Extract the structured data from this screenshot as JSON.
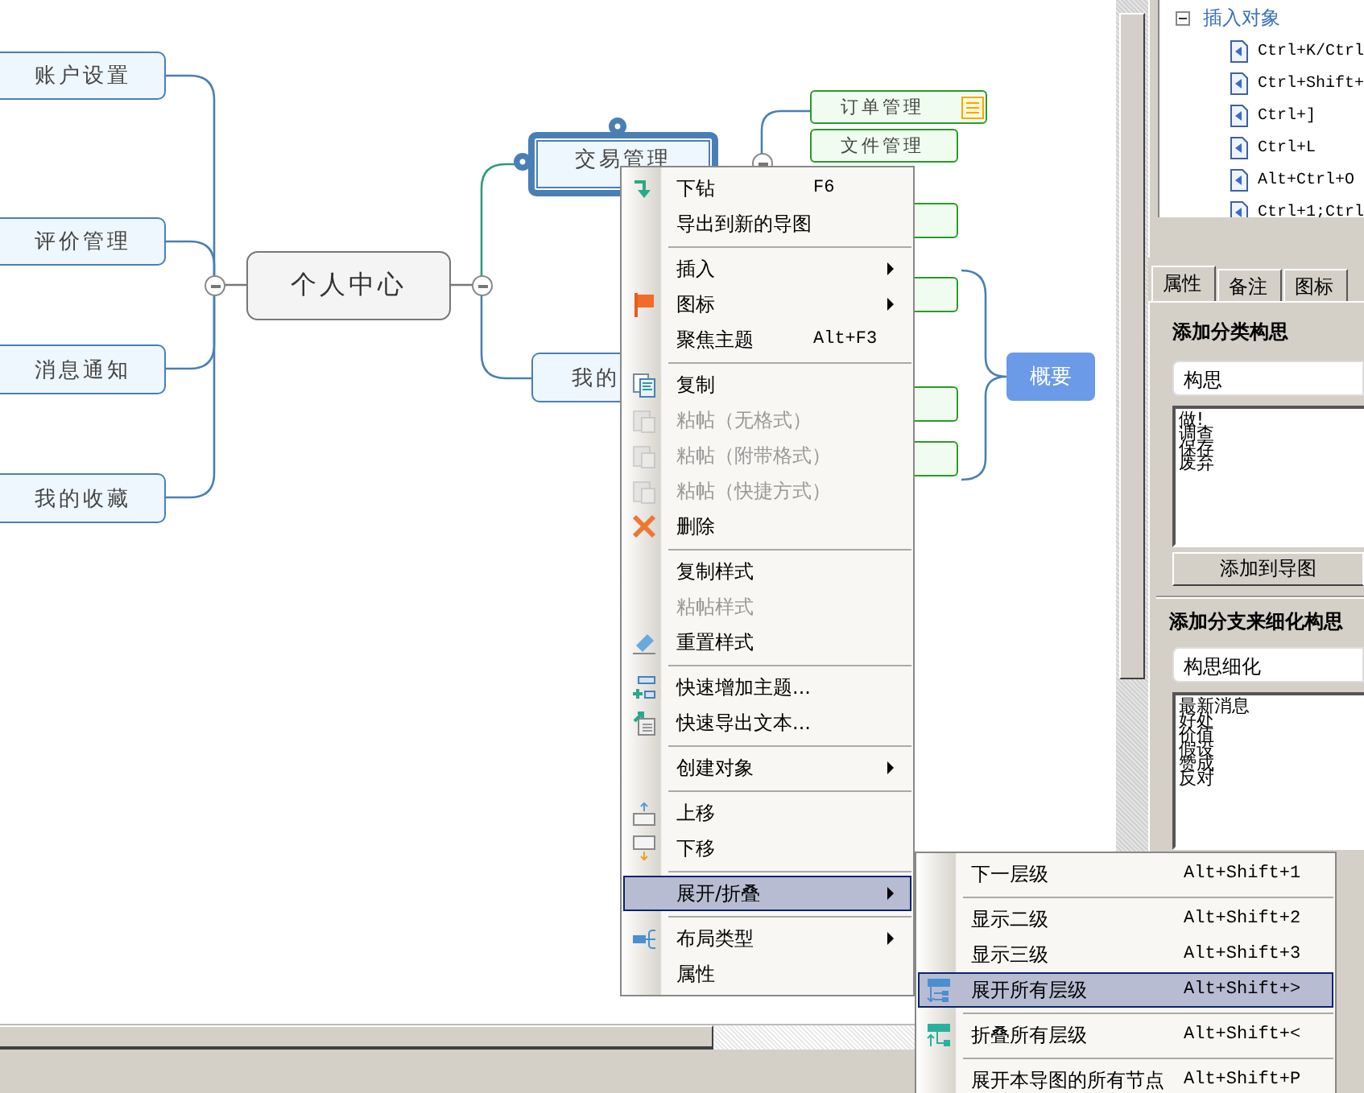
{
  "mind_map": {
    "left_topics": [
      {
        "text": "账户设置"
      },
      {
        "text": "评价管理"
      },
      {
        "text": "消息通知"
      },
      {
        "text": "我的收藏"
      }
    ],
    "central_topic": {
      "text": "个人中心"
    },
    "right_topics": [
      {
        "text": "交易管理",
        "selected": true
      },
      {
        "text": "我的",
        "selected": false
      }
    ],
    "subtopics": [
      {
        "kind": "topic",
        "text": "订单管理",
        "has_note": true
      },
      {
        "kind": "topic",
        "text": "文件管理",
        "has_note": false
      },
      {
        "kind": "blank",
        "has_note": false
      },
      {
        "kind": "blank",
        "has_note": false
      },
      {
        "kind": "blank",
        "has_note": false
      },
      {
        "kind": "blank",
        "has_note": false
      }
    ],
    "summary": {
      "text": "概要"
    }
  },
  "context_menu": {
    "items": [
      {
        "kind": "item",
        "label": "下钻",
        "shortcut": "F6",
        "has_submenu": false,
        "disabled": false,
        "selected": false
      },
      {
        "kind": "item",
        "label": "导出到新的导图",
        "has_submenu": false,
        "disabled": false,
        "selected": false
      },
      {
        "kind": "separator"
      },
      {
        "kind": "item",
        "label": "插入",
        "has_submenu": true,
        "disabled": false,
        "selected": false
      },
      {
        "kind": "item",
        "label": "图标",
        "has_submenu": true,
        "disabled": false,
        "selected": false
      },
      {
        "kind": "item",
        "label": "聚焦主题",
        "shortcut": "Alt+F3",
        "has_submenu": false,
        "disabled": false,
        "selected": false
      },
      {
        "kind": "separator"
      },
      {
        "kind": "item",
        "label": "复制",
        "has_submenu": false,
        "disabled": false,
        "selected": false
      },
      {
        "kind": "item",
        "label": "粘帖（无格式）",
        "has_submenu": false,
        "disabled": true,
        "selected": false
      },
      {
        "kind": "item",
        "label": "粘帖（附带格式）",
        "has_submenu": false,
        "disabled": true,
        "selected": false
      },
      {
        "kind": "item",
        "label": "粘帖（快捷方式）",
        "has_submenu": false,
        "disabled": true,
        "selected": false
      },
      {
        "kind": "item",
        "label": "删除",
        "has_submenu": false,
        "disabled": false,
        "selected": false
      },
      {
        "kind": "separator"
      },
      {
        "kind": "item",
        "label": "复制样式",
        "has_submenu": false,
        "disabled": false,
        "selected": false
      },
      {
        "kind": "item",
        "label": "粘帖样式",
        "has_submenu": false,
        "disabled": true,
        "selected": false
      },
      {
        "kind": "item",
        "label": "重置样式",
        "has_submenu": false,
        "disabled": false,
        "selected": false
      },
      {
        "kind": "separator"
      },
      {
        "kind": "item",
        "label": "快速增加主题...",
        "has_submenu": false,
        "disabled": false,
        "selected": false
      },
      {
        "kind": "item",
        "label": "快速导出文本...",
        "has_submenu": false,
        "disabled": false,
        "selected": false
      },
      {
        "kind": "separator"
      },
      {
        "kind": "item",
        "label": "创建对象",
        "has_submenu": true,
        "disabled": false,
        "selected": false
      },
      {
        "kind": "separator"
      },
      {
        "kind": "item",
        "label": "上移",
        "has_submenu": false,
        "disabled": false,
        "selected": false
      },
      {
        "kind": "item",
        "label": "下移",
        "has_submenu": false,
        "disabled": false,
        "selected": false
      },
      {
        "kind": "separator"
      },
      {
        "kind": "item",
        "label": "展开/折叠",
        "has_submenu": true,
        "disabled": false,
        "selected": true
      },
      {
        "kind": "separator"
      },
      {
        "kind": "item",
        "label": "布局类型",
        "has_submenu": true,
        "disabled": false,
        "selected": false
      },
      {
        "kind": "item",
        "label": "属性",
        "has_submenu": false,
        "disabled": false,
        "selected": false
      }
    ]
  },
  "submenu": {
    "items": [
      {
        "kind": "item",
        "label": "下一层级",
        "shortcut": "Alt+Shift+1",
        "selected": false
      },
      {
        "kind": "separator"
      },
      {
        "kind": "item",
        "label": "显示二级",
        "shortcut": "Alt+Shift+2",
        "selected": false
      },
      {
        "kind": "item",
        "label": "显示三级",
        "shortcut": "Alt+Shift+3",
        "selected": false
      },
      {
        "kind": "item",
        "label": "展开所有层级",
        "shortcut": "Alt+Shift+>",
        "selected": true
      },
      {
        "kind": "separator"
      },
      {
        "kind": "item",
        "label": "折叠所有层级",
        "shortcut": "Alt+Shift+<",
        "selected": false
      },
      {
        "kind": "separator"
      },
      {
        "kind": "item",
        "label": "展开本导图的所有节点",
        "shortcut": "Alt+Shift+P",
        "selected": false
      }
    ]
  },
  "shortcut_tree": {
    "label": "插入对象",
    "expanded": true,
    "children": [
      "Ctrl+K/Ctrl",
      "Ctrl+Shift+",
      "Ctrl+]",
      "Ctrl+L",
      "Alt+Ctrl+O",
      "Ctrl+1;Ctrl"
    ]
  },
  "tabs": [
    {
      "label": "属性",
      "selected": true
    },
    {
      "label": "备注",
      "selected": false
    },
    {
      "label": "图标",
      "selected": false
    }
  ],
  "categories": {
    "heading": "添加分类构思",
    "input_value": "构思",
    "list": [
      "做!",
      "调查",
      "保存",
      "废弃"
    ],
    "button": "添加到导图"
  },
  "branches": {
    "heading": "添加分支来细化构思",
    "input_value": "构思细化",
    "list": [
      "最新消息",
      "好处",
      "价值",
      "假设",
      "赞成",
      "反对"
    ]
  }
}
